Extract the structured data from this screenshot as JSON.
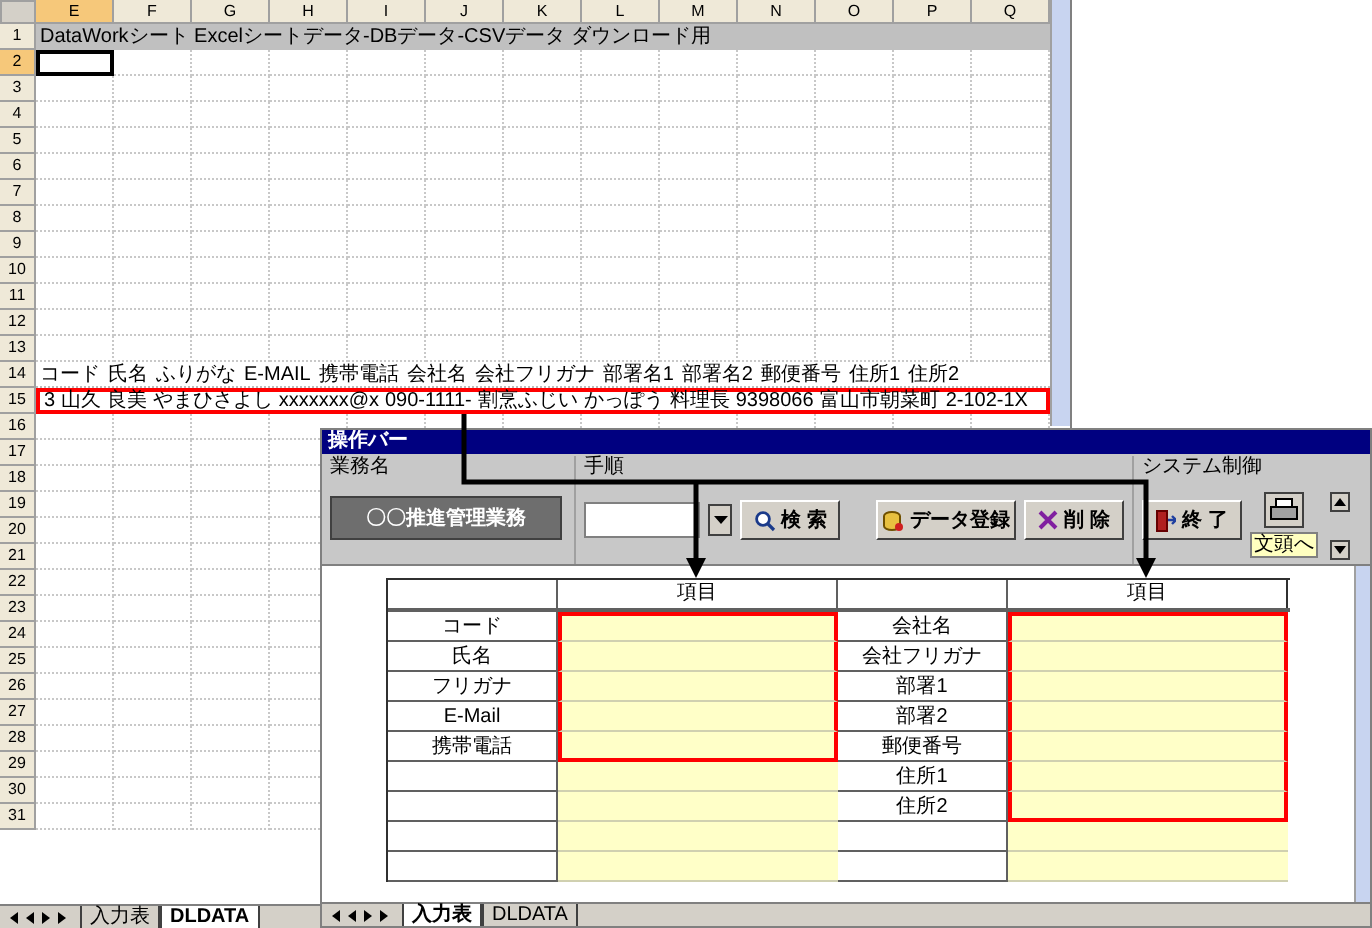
{
  "spreadsheet": {
    "columns": [
      {
        "label": "E",
        "selected": true
      },
      {
        "label": "F",
        "selected": false
      },
      {
        "label": "G",
        "selected": false
      },
      {
        "label": "H",
        "selected": false
      },
      {
        "label": "I",
        "selected": false
      },
      {
        "label": "J",
        "selected": false
      },
      {
        "label": "K",
        "selected": false
      },
      {
        "label": "L",
        "selected": false
      },
      {
        "label": "M",
        "selected": false
      },
      {
        "label": "N",
        "selected": false
      },
      {
        "label": "O",
        "selected": false
      },
      {
        "label": "P",
        "selected": false
      },
      {
        "label": "Q",
        "selected": false
      }
    ],
    "rows": [
      {
        "label": "1",
        "selected": false
      },
      {
        "label": "2",
        "selected": true
      },
      {
        "label": "3",
        "selected": false
      },
      {
        "label": "4",
        "selected": false
      },
      {
        "label": "5",
        "selected": false
      },
      {
        "label": "6",
        "selected": false
      },
      {
        "label": "7",
        "selected": false
      },
      {
        "label": "8",
        "selected": false
      },
      {
        "label": "9",
        "selected": false
      },
      {
        "label": "10",
        "selected": false
      },
      {
        "label": "11",
        "selected": false
      },
      {
        "label": "12",
        "selected": false
      },
      {
        "label": "13",
        "selected": false
      },
      {
        "label": "14",
        "selected": false
      },
      {
        "label": "15",
        "selected": false
      },
      {
        "label": "16",
        "selected": false
      },
      {
        "label": "17",
        "selected": false
      },
      {
        "label": "18",
        "selected": false
      },
      {
        "label": "19",
        "selected": false
      },
      {
        "label": "20",
        "selected": false
      },
      {
        "label": "21",
        "selected": false
      },
      {
        "label": "22",
        "selected": false
      },
      {
        "label": "23",
        "selected": false
      },
      {
        "label": "24",
        "selected": false
      },
      {
        "label": "25",
        "selected": false
      },
      {
        "label": "26",
        "selected": false
      },
      {
        "label": "27",
        "selected": false
      },
      {
        "label": "28",
        "selected": false
      },
      {
        "label": "29",
        "selected": false
      },
      {
        "label": "30",
        "selected": false
      },
      {
        "label": "31",
        "selected": false
      }
    ],
    "title_row": "DataWorkシート Excelシートデータ-DBデータ-CSVデータ ダウンロード用",
    "header_cells": [
      "コード",
      "氏名",
      "ふりがな",
      "E-MAIL",
      "携帯電話",
      "会社名",
      "会社フリガナ",
      "部署名1",
      "部署名2",
      "郵便番号",
      "住所1",
      "住所2"
    ],
    "data_cells": [
      "3",
      "山久 良美",
      "やまひさよし",
      "xxxxxxx@x",
      "090-1111-",
      "割烹ふじい",
      "かっぽう",
      "料理長",
      "9398066",
      "富山市朝菜町",
      "2-102-1X"
    ],
    "data_highlighted": true,
    "sheet_tabs": [
      {
        "label": "入力表",
        "selected": false
      },
      {
        "label": "DLDATA",
        "selected": true
      }
    ]
  },
  "window": {
    "title": "操作バー",
    "toolbar": {
      "task_label": "業務名",
      "task_button": "〇〇推進管理業務",
      "step_label": "手順",
      "step_buttons": [
        {
          "kind": "search",
          "label": "検 索"
        },
        {
          "kind": "register",
          "label": "データ登録"
        },
        {
          "kind": "delete",
          "label": "削 除"
        }
      ],
      "system_label": "システム制御",
      "exit_button": "終 了",
      "tooltip": "文頭へ"
    },
    "form": {
      "headers": [
        "項目",
        "項目"
      ],
      "rows": [
        {
          "left_label": "コード",
          "left_highlighted": true,
          "right_label": "会社名",
          "right_highlighted": true
        },
        {
          "left_label": "氏名",
          "left_highlighted": true,
          "right_label": "会社フリガナ",
          "right_highlighted": true
        },
        {
          "left_label": "フリガナ",
          "left_highlighted": true,
          "right_label": "部署1",
          "right_highlighted": true
        },
        {
          "left_label": "E-Mail",
          "left_highlighted": true,
          "right_label": "部署2",
          "right_highlighted": true
        },
        {
          "left_label": "携帯電話",
          "left_highlighted": true,
          "right_label": "郵便番号",
          "right_highlighted": true
        },
        {
          "left_highlighted": false,
          "right_label": "住所1",
          "right_highlighted": true
        },
        {
          "left_highlighted": false,
          "right_label": "住所2",
          "right_highlighted": true
        },
        {
          "left_highlighted": false,
          "right_highlighted": false
        },
        {
          "left_highlighted": false,
          "right_highlighted": false
        }
      ]
    },
    "sheet_tabs": [
      {
        "label": "入力表",
        "selected": true
      },
      {
        "label": "DLDATA",
        "selected": false
      }
    ]
  }
}
